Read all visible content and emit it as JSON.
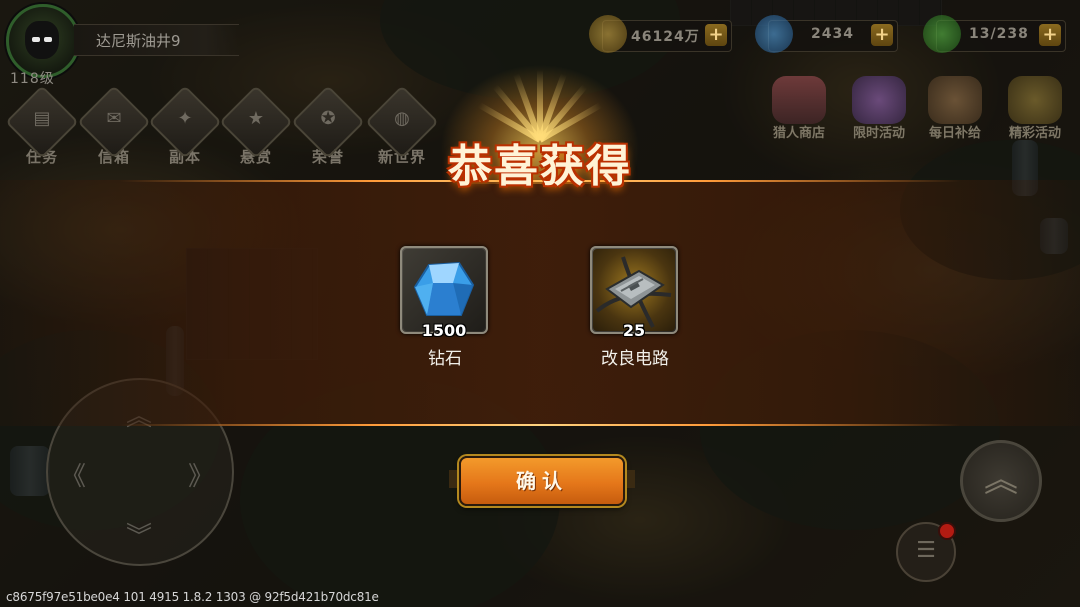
{
  "player": {
    "name": "达尼斯油井9",
    "level": "118级"
  },
  "menu": [
    {
      "label": "任务",
      "icon": "book-icon",
      "glyph": "▤"
    },
    {
      "label": "信箱",
      "icon": "mailbox-icon",
      "glyph": "✉"
    },
    {
      "label": "副本",
      "icon": "wings-icon",
      "glyph": "✦"
    },
    {
      "label": "悬赏",
      "icon": "star-badge-icon",
      "glyph": "★"
    },
    {
      "label": "荣誉",
      "icon": "honor-badge-icon",
      "glyph": "✪"
    },
    {
      "label": "新世界",
      "icon": "globe-icon",
      "glyph": "◍"
    }
  ],
  "resources": {
    "gold": {
      "value": "46124万",
      "color": "#c9a23a"
    },
    "diamond": {
      "value": "2434",
      "color": "#3b82c8"
    },
    "energy": {
      "value": "13/238",
      "color": "#3ea23a"
    }
  },
  "events": [
    {
      "label": "猎人商店",
      "icon": "shop-icon"
    },
    {
      "label": "限时活动",
      "icon": "limited-event-icon"
    },
    {
      "label": "每日补给",
      "icon": "daily-supply-icon"
    },
    {
      "label": "精彩活动",
      "icon": "featured-event-icon"
    }
  ],
  "reward": {
    "title": "恭喜获得",
    "items": [
      {
        "name": "钻石",
        "quantity": "1500",
        "icon": "diamond-icon"
      },
      {
        "name": "改良电路",
        "quantity": "25",
        "icon": "circuit-board-icon"
      }
    ],
    "confirm_label": "确认"
  },
  "footer": {
    "build_info": "c8675f97e51be0e4 101 4915 1.8.2 1303 @ 92f5d421b70dc81e"
  },
  "colors": {
    "accent": "#f39a2b",
    "band_line": "#ff9b3a",
    "title_outline": "#b83200"
  }
}
